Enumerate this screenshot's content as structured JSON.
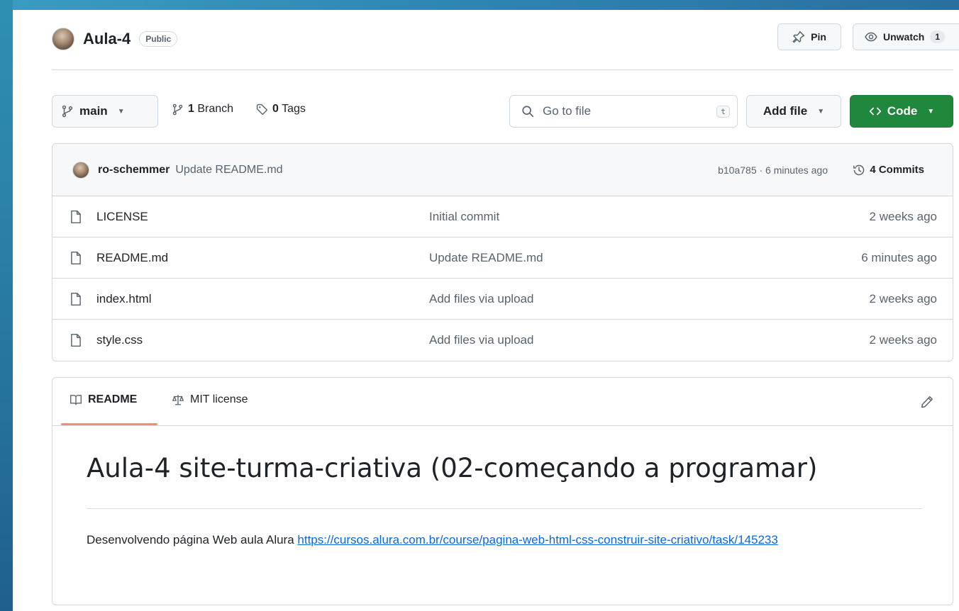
{
  "repo": {
    "name": "Aula-4",
    "visibility": "Public"
  },
  "actions": {
    "pin_label": "Pin",
    "watch_label": "Unwatch",
    "watch_count": "1"
  },
  "toolbar": {
    "branch": "main",
    "branches_count": "1",
    "branches_label": "Branch",
    "tags_count": "0",
    "tags_label": "Tags",
    "search_placeholder": "Go to file",
    "search_shortcut": "t",
    "add_file_label": "Add file",
    "code_label": "Code"
  },
  "latest_commit": {
    "author": "ro-schemmer",
    "message": "Update README.md",
    "meta": "b10a785 · 6 minutes ago",
    "commits_label": "4 Commits"
  },
  "files": [
    {
      "name": "LICENSE",
      "commit": "Initial commit",
      "time": "2 weeks ago"
    },
    {
      "name": "README.md",
      "commit": "Update README.md",
      "time": "6 minutes ago"
    },
    {
      "name": "index.html",
      "commit": "Add files via upload",
      "time": "2 weeks ago"
    },
    {
      "name": "style.css",
      "commit": "Add files via upload",
      "time": "2 weeks ago"
    }
  ],
  "readme": {
    "tab_readme": "README",
    "tab_license": "MIT license",
    "title": "Aula-4 site-turma-criativa (02-começando a programar)",
    "text": "Desenvolvendo página Web aula Alura",
    "link": "https://cursos.alura.com.br/course/pagina-web-html-css-construir-site-criativo/task/145233"
  },
  "colors": {
    "accent_green": "#1f883d",
    "link_blue": "#0969da",
    "tab_underline": "#fd8c73"
  }
}
